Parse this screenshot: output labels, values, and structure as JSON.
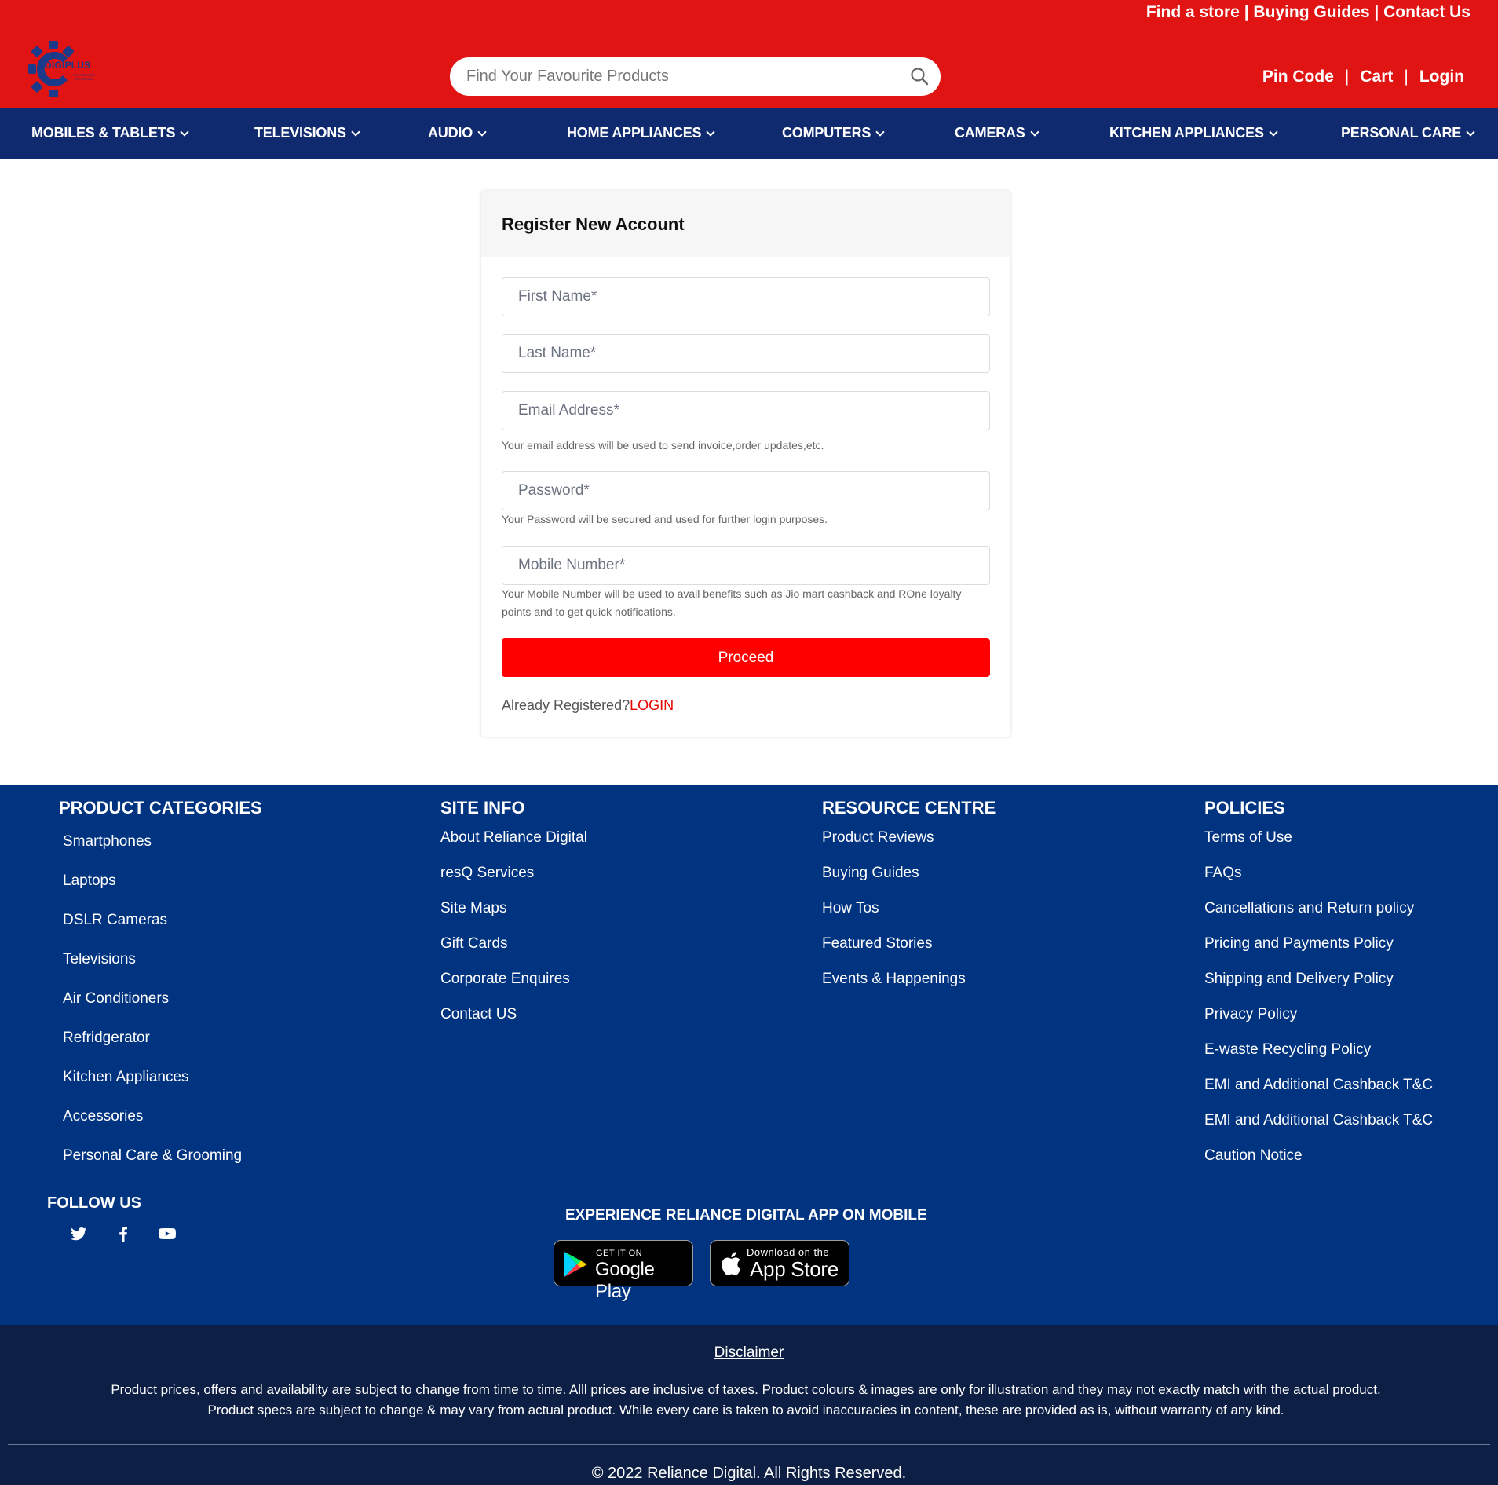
{
  "header": {
    "top_links": [
      "Find a store",
      "Buying Guides",
      "Contact Us"
    ],
    "logo_text": "DIGIPLUS",
    "logo_tagline": "THE NEW AGE OF DIGITAL",
    "search_placeholder": "Find Your Favourite Products",
    "user_links": [
      "Pin Code",
      "Cart",
      "Login"
    ],
    "colors": {
      "header_bg": "#e11414",
      "nav_bg": "#0f2a6e",
      "logo_blue": "#1b3a8a"
    }
  },
  "nav": {
    "items": [
      "MOBILES & TABLETS",
      "TELEVISIONS",
      "AUDIO",
      "HOME APPLIANCES",
      "COMPUTERS",
      "CAMERAS",
      "KITCHEN APPLIANCES",
      "PERSONAL CARE"
    ]
  },
  "register": {
    "title": "Register New Account",
    "fields": {
      "first_name": "First Name*",
      "last_name": "Last Name*",
      "email": "Email Address*",
      "password": "Password*",
      "mobile": "Mobile Number*"
    },
    "hints": {
      "email": "Your email address will be used to send invoice,order updates,etc.",
      "password": "Your Password will be secured and used for further login purposes.",
      "mobile": "Your Mobile Number will be used to avail benefits such as Jio mart cashback and ROne loyalty points and to get quick notifications."
    },
    "proceed_label": "Proceed",
    "already_text": "Already Registered?",
    "login_link": "LOGIN",
    "colors": {
      "proceed_bg": "#ff0000",
      "login_link": "#e60000"
    }
  },
  "footer": {
    "product_categories": {
      "title": "PRODUCT CATEGORIES",
      "items": [
        "Smartphones",
        "Laptops",
        "DSLR Cameras",
        "Televisions",
        "Air Conditioners",
        "Refridgerator",
        "Kitchen Appliances",
        "Accessories",
        "Personal Care & Grooming"
      ]
    },
    "site_info": {
      "title": "SITE INFO",
      "items": [
        "About Reliance Digital",
        "resQ Services",
        "Site Maps",
        "Gift Cards",
        "Corporate Enquires",
        "Contact US"
      ]
    },
    "resource_centre": {
      "title": "RESOURCE CENTRE",
      "items": [
        "Product Reviews",
        "Buying Guides",
        "How Tos",
        "Featured Stories",
        "Events & Happenings"
      ]
    },
    "policies": {
      "title": "POLICIES",
      "items": [
        "Terms of Use",
        "FAQs",
        "Cancellations and Return policy",
        "Pricing and Payments Policy",
        "Shipping and Delivery Policy",
        "Privacy Policy",
        "E-waste Recycling Policy",
        "EMI and Additional Cashback T&C",
        "EMI and Additional Cashback T&C",
        "Caution Notice"
      ]
    },
    "follow_title": "FOLLOW US",
    "social_icons": [
      "twitter-icon",
      "facebook-icon",
      "youtube-icon"
    ],
    "app_title": "EXPERIENCE RELIANCE DIGITAL APP ON MOBILE",
    "google_play": {
      "small": "GET IT ON",
      "big": "Google Play"
    },
    "app_store": {
      "small": "Download on the",
      "big": "App Store"
    },
    "colors": {
      "footer_bg": "#003380",
      "bottom_bg": "#0d1f44"
    }
  },
  "bottom": {
    "disclaimer_title": "Disclaimer",
    "disclaimer_text": "Product prices, offers and availability are subject to change from time to time. Alll prices are inclusive of taxes. Product colours & images are only for illustration and they may not exactly match with the actual product. Product specs are subject to change & may vary from actual product. While every care is taken to avoid inaccuracies in content, these are provided as is, without warranty of any kind.",
    "copyright": "© 2022 Reliance Digital. All Rights Reserved."
  }
}
